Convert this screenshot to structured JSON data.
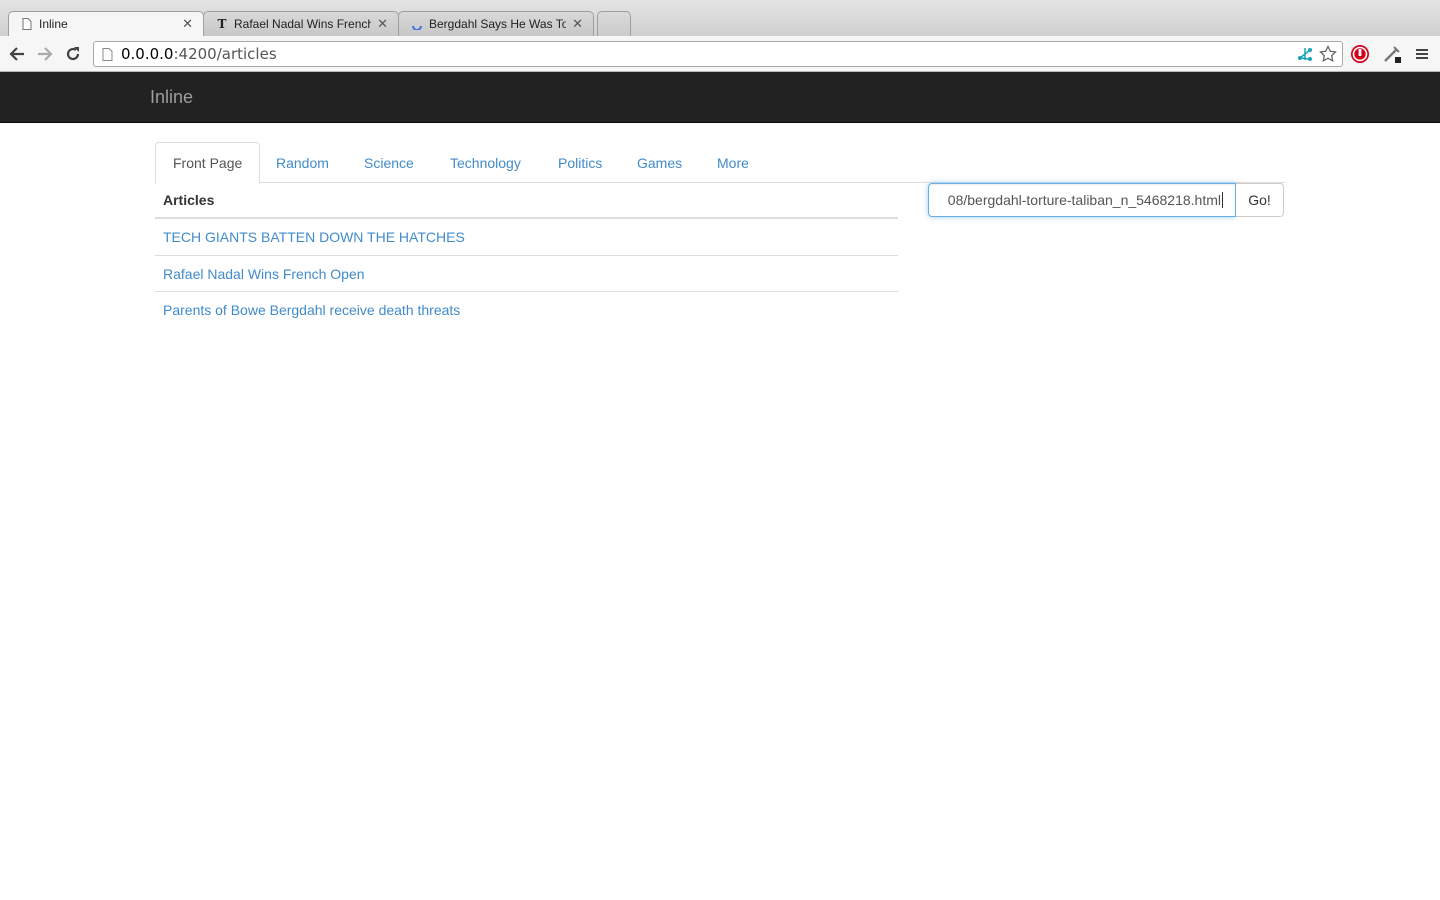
{
  "browser": {
    "tabs": [
      {
        "title": "Inline"
      },
      {
        "title": "Rafael Nadal Wins French Open"
      },
      {
        "title": "Bergdahl Says He Was Tortured"
      }
    ],
    "address": {
      "host": "0.0.0.0",
      "rest": ":4200/articles"
    }
  },
  "navbar": {
    "brand": "Inline"
  },
  "nav_tabs": [
    {
      "label": "Front Page"
    },
    {
      "label": "Random"
    },
    {
      "label": "Science"
    },
    {
      "label": "Technology"
    },
    {
      "label": "Politics"
    },
    {
      "label": "Games"
    },
    {
      "label": "More"
    }
  ],
  "articles": {
    "header": "Articles",
    "items": [
      {
        "title": "TECH GIANTS BATTEN DOWN THE HATCHES"
      },
      {
        "title": "Rafael Nadal Wins French Open"
      },
      {
        "title": "Parents of Bowe Bergdahl receive death threats"
      }
    ]
  },
  "url_form": {
    "value": "08/bergdahl-torture-taliban_n_5468218.html",
    "submit_label": "Go!"
  },
  "colors": {
    "navbar_bg": "#222222",
    "link": "#428bca",
    "brand": "#9d9d9d"
  }
}
